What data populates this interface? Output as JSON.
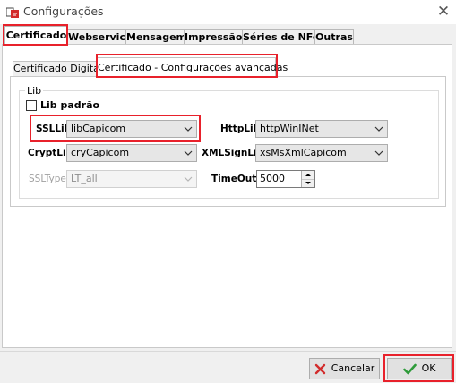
{
  "window": {
    "title": "Configurações",
    "close_glyph": "✕"
  },
  "outer_tabs": [
    "Certificado",
    "Webservice",
    "Mensagem",
    "Impressão",
    "Séries de NFe",
    "Outras"
  ],
  "inner_tabs": [
    "Certificado Digital",
    "Certificado - Configurações avançadas"
  ],
  "lib_group": {
    "legend": "Lib",
    "checkbox_label": "Lib padrão",
    "ssllib_label": "SSLLib",
    "ssllib_value": "libCapicom",
    "httplib_label": "HttpLib",
    "httplib_value": "httpWinINet",
    "cryptlib_label": "CryptLib",
    "cryptlib_value": "cryCapicom",
    "xmlsignlib_label": "XMLSignLib",
    "xmlsignlib_value": "xsMsXmlCapicom",
    "ssltype_label": "SSLType",
    "ssltype_value": "LT_all",
    "timeout_label": "TimeOut",
    "timeout_value": "5000"
  },
  "buttons": {
    "cancel": "Cancelar",
    "ok": "OK"
  },
  "colors": {
    "highlight": "#e8212b",
    "ok_check": "#2e9b3a",
    "cancel_x": "#d22b2b"
  },
  "icons": {
    "app": "app-icon",
    "close": "close-icon",
    "cancel": "x-icon",
    "ok": "check-icon"
  }
}
